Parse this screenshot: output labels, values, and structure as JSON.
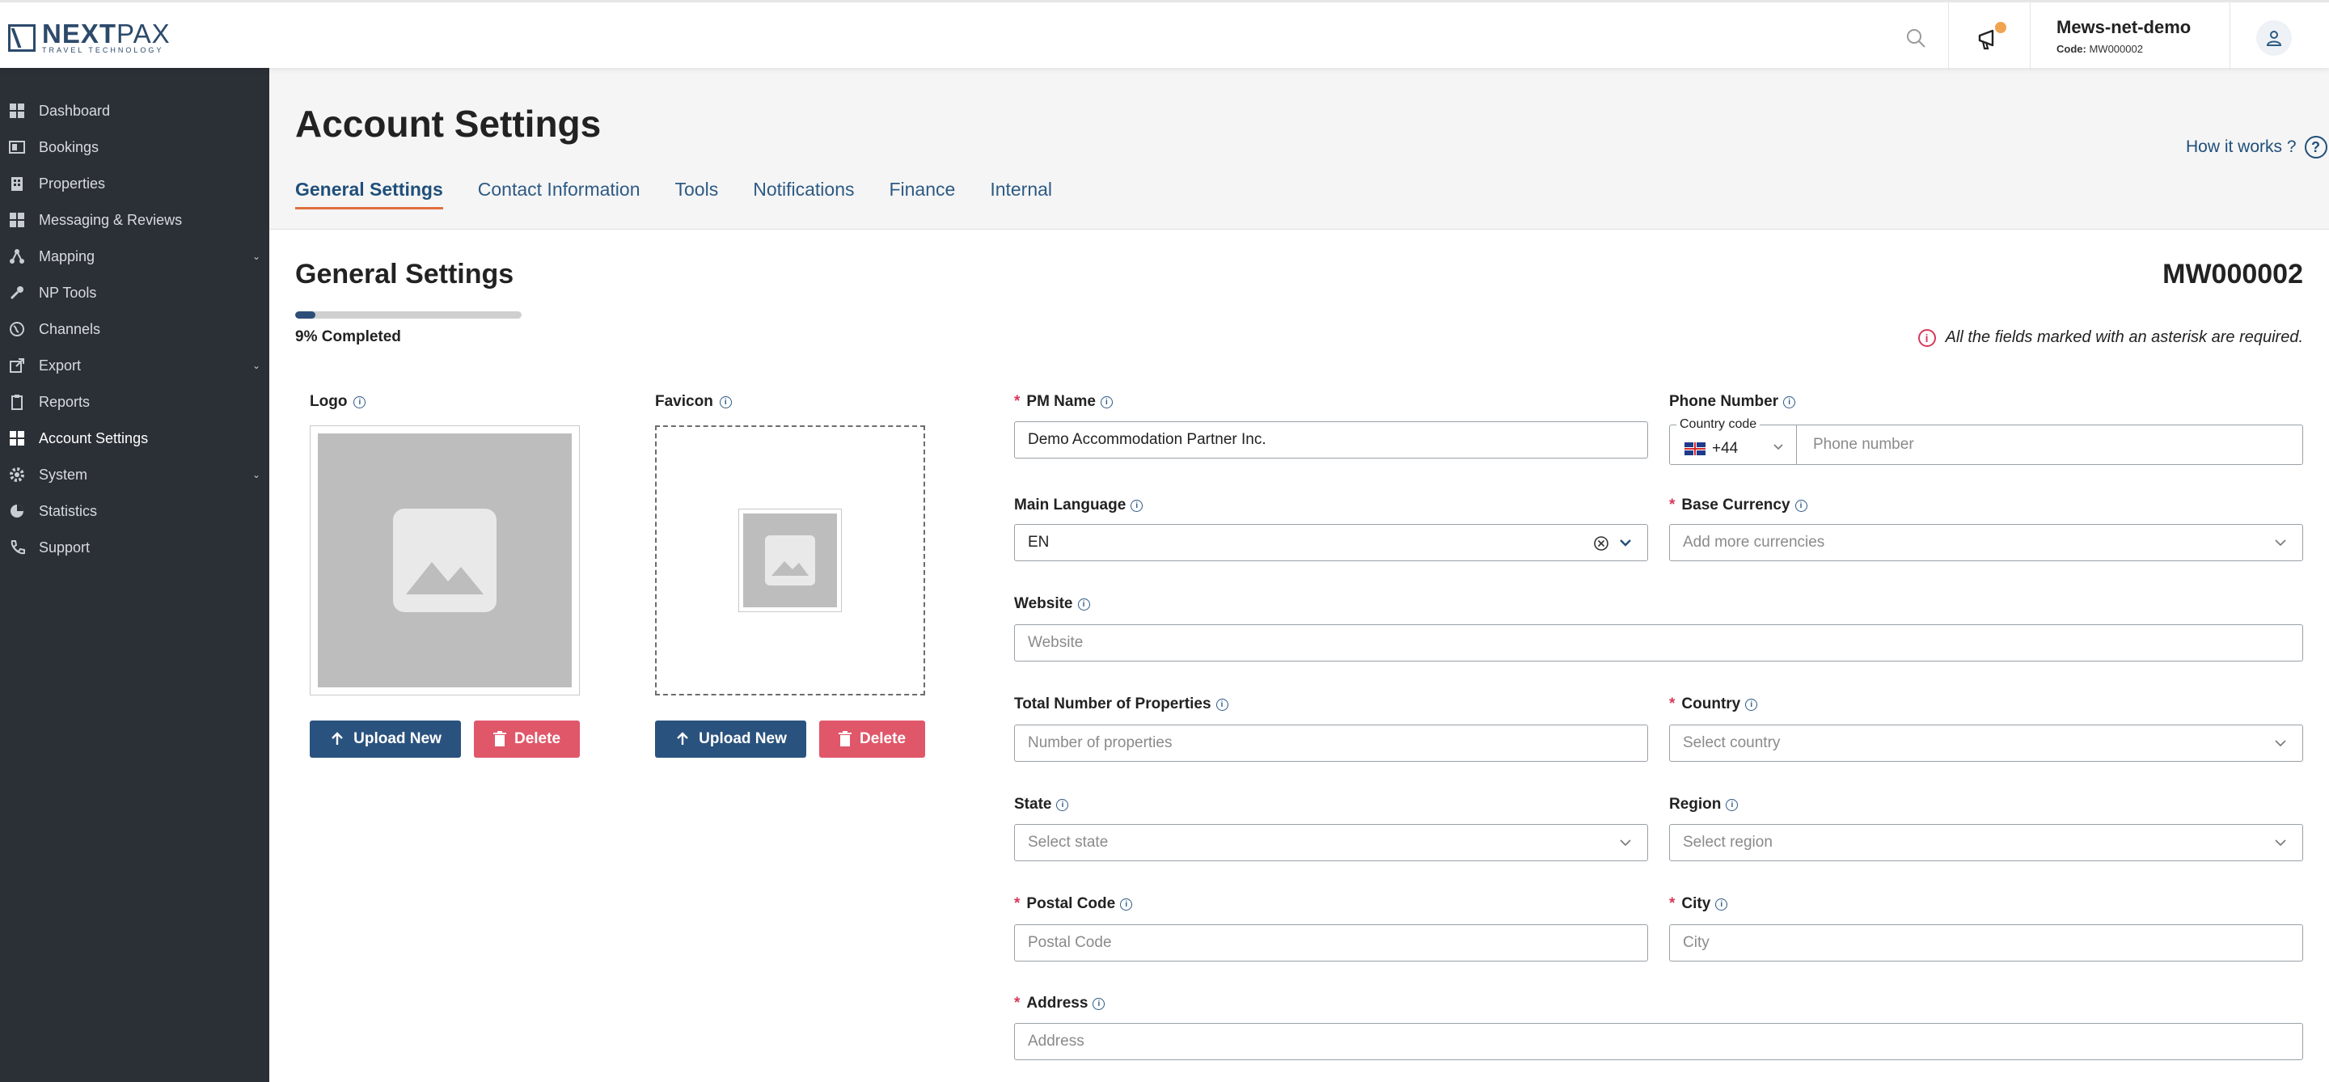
{
  "brand": {
    "name_bold": "NEXT",
    "name_thin": "PAX",
    "tagline": "TRAVEL TECHNOLOGY"
  },
  "account": {
    "name": "Mews-net-demo",
    "code_label": "Code:",
    "code_value": "MW000002"
  },
  "sidebar": {
    "items": [
      {
        "label": "Dashboard",
        "icon": "dashboard-icon"
      },
      {
        "label": "Bookings",
        "icon": "bookings-icon"
      },
      {
        "label": "Properties",
        "icon": "properties-icon"
      },
      {
        "label": "Messaging & Reviews",
        "icon": "messaging-icon"
      },
      {
        "label": "Mapping",
        "icon": "mapping-icon",
        "expandable": true
      },
      {
        "label": "NP Tools",
        "icon": "wrench-icon"
      },
      {
        "label": "Channels",
        "icon": "globe-icon"
      },
      {
        "label": "Export",
        "icon": "export-icon",
        "expandable": true
      },
      {
        "label": "Reports",
        "icon": "clipboard-icon"
      },
      {
        "label": "Account Settings",
        "icon": "account-settings-icon",
        "active": true
      },
      {
        "label": "System",
        "icon": "gear-icon",
        "expandable": true
      },
      {
        "label": "Statistics",
        "icon": "pie-chart-icon"
      },
      {
        "label": "Support",
        "icon": "phone-icon"
      }
    ]
  },
  "header": {
    "title": "Account Settings",
    "help_link": "How it works ?",
    "tabs": [
      {
        "label": "General Settings",
        "active": true
      },
      {
        "label": "Contact Information"
      },
      {
        "label": "Tools"
      },
      {
        "label": "Notifications"
      },
      {
        "label": "Finance"
      },
      {
        "label": "Internal"
      }
    ]
  },
  "general": {
    "title": "General Settings",
    "code": "MW000002",
    "progress_percent": 9,
    "progress_text": "9% Completed",
    "required_note": "All the fields marked with an asterisk are required."
  },
  "images": {
    "logo_label": "Logo",
    "favicon_label": "Favicon",
    "upload_label": "Upload New",
    "delete_label": "Delete"
  },
  "form": {
    "pm_name": {
      "label": "PM Name",
      "value": "Demo Accommodation Partner Inc."
    },
    "phone": {
      "label": "Phone Number",
      "cc_legend": "Country code",
      "cc_value": "+44",
      "placeholder": "Phone number"
    },
    "main_language": {
      "label": "Main Language",
      "value": "EN"
    },
    "base_currency": {
      "label": "Base Currency",
      "placeholder": "Add more currencies"
    },
    "website": {
      "label": "Website",
      "placeholder": "Website"
    },
    "total_properties": {
      "label": "Total Number of Properties",
      "placeholder": "Number of properties"
    },
    "country": {
      "label": "Country",
      "placeholder": "Select country"
    },
    "state": {
      "label": "State",
      "placeholder": "Select state"
    },
    "region": {
      "label": "Region",
      "placeholder": "Select region"
    },
    "postal_code": {
      "label": "Postal Code",
      "placeholder": "Postal Code"
    },
    "city": {
      "label": "City",
      "placeholder": "City"
    },
    "address": {
      "label": "Address",
      "placeholder": "Address"
    }
  },
  "colors": {
    "primary": "#2a527e",
    "danger": "#e0576a",
    "accent_tab": "#e0703f",
    "sidebar_bg": "#2b2f36",
    "notify_dot": "#f0a450"
  }
}
